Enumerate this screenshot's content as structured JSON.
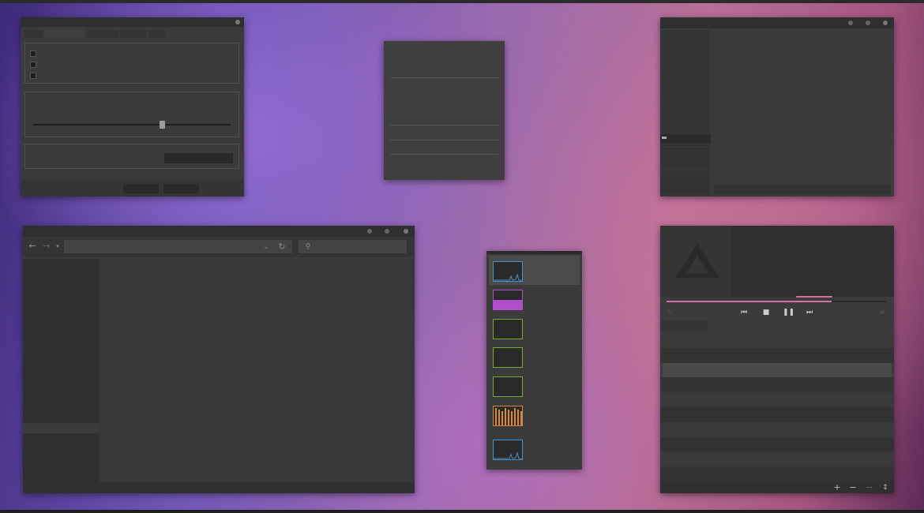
{
  "desktop": {
    "background": {
      "colors": [
        "#3d2a7a",
        "#6e55b5",
        "#9b6ab0",
        "#b86f95",
        "#a45580",
        "#5d2b55"
      ]
    }
  },
  "settings_window": {
    "slider_fraction": 0.65,
    "checkboxes": [
      {
        "checked": false
      },
      {
        "checked": false
      },
      {
        "checked": false
      }
    ]
  },
  "browser_window": {
    "icons": [
      "back-icon",
      "forward-icon",
      "dropdown-icon",
      "refresh-icon",
      "search-icon"
    ]
  },
  "system_monitor": {
    "graph_colors": [
      "#4a90c8",
      "#b04fc9",
      "#7aa63a",
      "#7aa63a",
      "#7aa63a",
      "#d9883a",
      "#4a90c8"
    ]
  },
  "music_player": {
    "progress_fraction": 0.75,
    "accent_color": "#d46fa0",
    "icons": [
      "previous-icon",
      "stop-icon",
      "pause-icon",
      "next-icon",
      "shuffle-icon",
      "repeat-icon"
    ],
    "footer": {
      "add_label": "+",
      "remove_label": "−",
      "more_label": "···",
      "sort_label": "↕"
    }
  }
}
